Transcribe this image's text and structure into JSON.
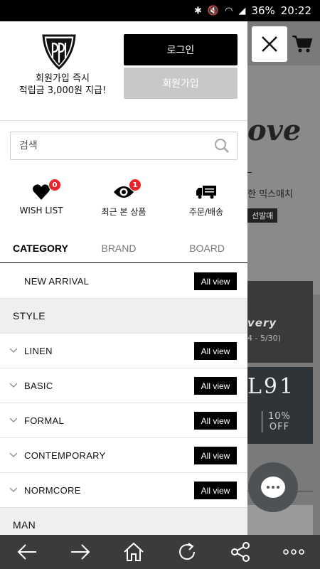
{
  "statusbar": {
    "battery": "36%",
    "time": "20:22"
  },
  "background": {
    "script_text": "ove",
    "mix_text": "한 믹스매치",
    "tag_text": "선발매",
    "banner1_title": "very",
    "banner1_sub": "4 - 5/30)",
    "banner2_title": "L91",
    "banner2_line1": "10%",
    "banner2_line2": "OFF"
  },
  "drawer": {
    "promo_line1": "회원가입 즉시",
    "promo_line2": "적립금 3,000원 지급!",
    "login_label": "로그인",
    "join_label": "회원가입",
    "search_placeholder": "검색",
    "quick": [
      {
        "label": "WISH LIST",
        "badge": "0",
        "icon": "heart-icon"
      },
      {
        "label": "최근 본 상품",
        "badge": "1",
        "icon": "eye-icon"
      },
      {
        "label": "주문/배송",
        "icon": "truck-icon"
      }
    ],
    "tabs": [
      "CATEGORY",
      "BRAND",
      "BOARD"
    ],
    "categories": [
      {
        "type": "item",
        "name": "NEW ARRIVAL",
        "btn": "All view",
        "chevron": false
      },
      {
        "type": "section",
        "name": "STYLE"
      },
      {
        "type": "item",
        "name": "LINEN",
        "btn": "All view",
        "chevron": true
      },
      {
        "type": "item",
        "name": "BASIC",
        "btn": "All view",
        "chevron": true
      },
      {
        "type": "item",
        "name": "FORMAL",
        "btn": "All view",
        "chevron": true
      },
      {
        "type": "item",
        "name": "CONTEMPORARY",
        "btn": "All view",
        "chevron": true
      },
      {
        "type": "item",
        "name": "NORMCORE",
        "btn": "All view",
        "chevron": true
      },
      {
        "type": "section",
        "name": "MAN"
      }
    ]
  },
  "colors": {
    "badge": "#e8242b",
    "navbar": "#3b3b3b"
  }
}
